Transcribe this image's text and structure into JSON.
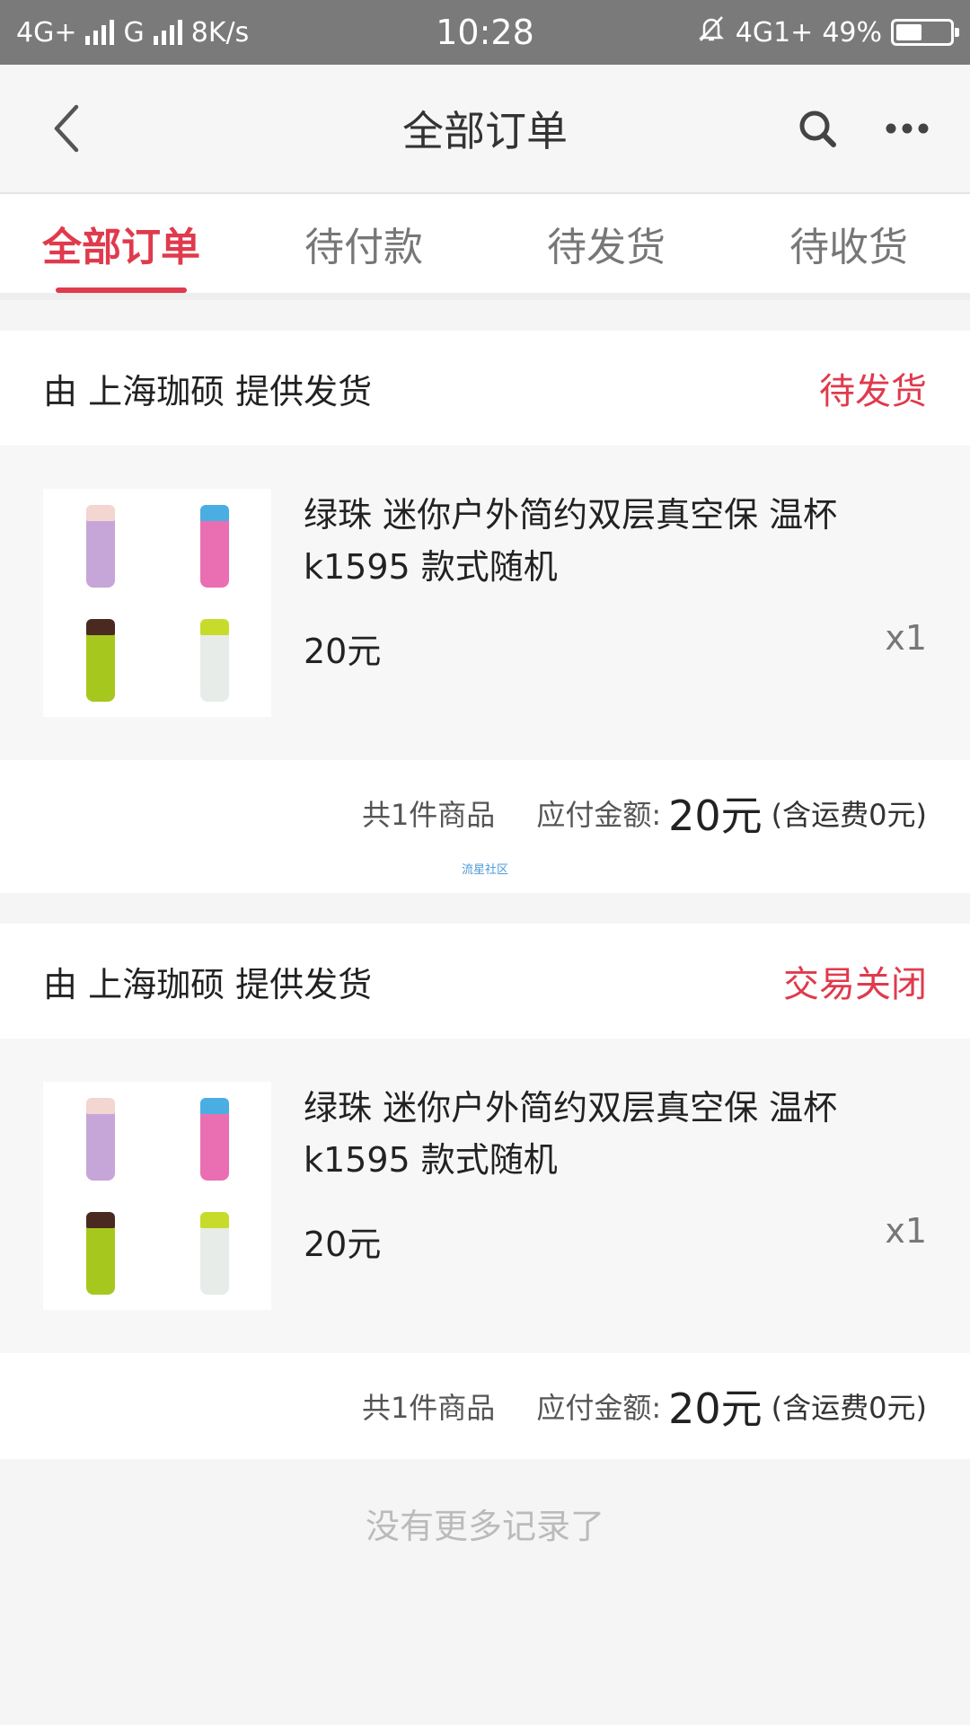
{
  "status_bar": {
    "network1": "4G+",
    "network2": "G",
    "speed": "8K/s",
    "time": "10:28",
    "network3": "4G1+",
    "battery": "49%",
    "battery_level": 0.49
  },
  "navbar": {
    "title": "全部订单"
  },
  "tabs": [
    {
      "label": "全部订单",
      "active": true
    },
    {
      "label": "待付款"
    },
    {
      "label": "待发货"
    },
    {
      "label": "待收货"
    }
  ],
  "orders": [
    {
      "supplier": "由 上海珈硕 提供发货",
      "status": "待发货",
      "item": {
        "name": "绿珠 迷你户外简约双层真空保 温杯 k1595 款式随机",
        "price": "20元",
        "quantity": "x1"
      },
      "summary": {
        "count_text": "共1件商品",
        "total_label": "应付金额:",
        "total_value": "20元",
        "shipping_text": "(含运费0元)"
      },
      "watermark": "流星社区"
    },
    {
      "supplier": "由 上海珈硕 提供发货",
      "status": "交易关闭",
      "item": {
        "name": "绿珠 迷你户外简约双层真空保 温杯 k1595 款式随机",
        "price": "20元",
        "quantity": "x1"
      },
      "summary": {
        "count_text": "共1件商品",
        "total_label": "应付金额:",
        "total_value": "20元",
        "shipping_text": "(含运费0元)"
      }
    }
  ],
  "footer": {
    "no_more_text": "没有更多记录了"
  },
  "colors": {
    "accent": "#e03a4d",
    "status_bar": "#7a7a7a"
  },
  "icons": {
    "back": "chevron-left-icon",
    "search": "search-icon",
    "more": "more-dots-icon",
    "product": "thermos-cups-image"
  }
}
